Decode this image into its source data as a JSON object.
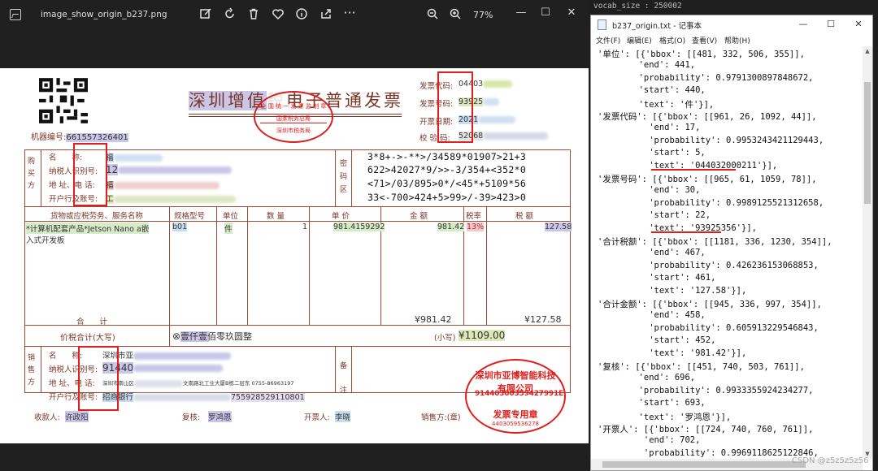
{
  "viewer": {
    "title": "image_show_origin_b237.png",
    "zoom": "77%",
    "icons": [
      "edit-icon",
      "rotate-icon",
      "delete-icon",
      "favorite-icon",
      "info-icon",
      "share-icon",
      "more-icon",
      "zoom-out-icon",
      "zoom-in-icon"
    ]
  },
  "invoice": {
    "title_prefix": "深圳增值",
    "title_suffix": "电子普通发票",
    "title_mid": "税",
    "stamp_top": "全 国 统 一 发 票 监 制 章",
    "stamp_mid": "国家税务总局",
    "stamp_bottom": "深圳市税务局",
    "meta": [
      {
        "label": "发票代码:",
        "value": "04403"
      },
      {
        "label": "发票号码:",
        "value": "93925"
      },
      {
        "label": "开票日期:",
        "value": "2021"
      },
      {
        "label": "校 验 码:",
        "value": "52068"
      }
    ],
    "machine_label": "机器编号:",
    "machine_value": "661557326401",
    "buyer_side": "购买方",
    "buyer_labels": [
      "名　　称:",
      "纳税人识别号:",
      "地 址、电 话:",
      "开户行及账号:"
    ],
    "buyer_values": [
      "福",
      "12",
      "福",
      "工"
    ],
    "cipher_side": "密码区",
    "cipher": [
      "3*8+->-**>/34589*01907>21+3",
      "622>42027*9/>>-3/354+<352*0",
      "<71>/03/895>0*/<45*+5109*56",
      "33<-700>424+5>99>/-39>423>0"
    ],
    "columns": [
      "货物或应税劳务、服务名称",
      "规格型号",
      "单位",
      "数 量",
      "单 价",
      "金 额",
      "税率",
      "税 额"
    ],
    "item": {
      "name_line1": "*计算机配套产品*Jetson Nano a嵌",
      "name_line2": "入式开发板",
      "spec": "b01",
      "unit": "件",
      "qty": "1",
      "price": "981.4159292",
      "amount": "981.42",
      "rate": "13%",
      "tax": "127.58"
    },
    "total_label": "合　　计",
    "total_amount": "¥981.42",
    "total_tax": "¥127.58",
    "grand_label": "价税合计(大写)",
    "grand_words": "壹仟壹佰零玖圆整",
    "grand_small_label": "(小写)",
    "grand_value": "¥1109.00",
    "seller_side": "销售方",
    "seller_labels": [
      "名　　称:",
      "纳税人识别号:",
      "地 址、电 话:",
      "开户行及账号:"
    ],
    "seller_name": "深圳市亚",
    "seller_tax": "91440",
    "seller_addr": "深圳市南山区",
    "seller_addr_tail": "文南路北工业大厦B栋二层东 0755-86963197",
    "seller_bank": "招商银行",
    "seller_bank_acct": "755928529110801",
    "remark_label": "备注",
    "seal_top": "深圳市亚博智能科技有限公司",
    "seal_tax": "91440300359427991E",
    "seal_bottom": "发票专用章",
    "seal_code": "4403059536278",
    "footer": [
      {
        "label": "收款人:",
        "value": "许政阳"
      },
      {
        "label": "复核:",
        "value": "罗鸿恩"
      },
      {
        "label": "开票人:",
        "value": "李晓"
      },
      {
        "label": "销售方:(章)",
        "value": ""
      }
    ]
  },
  "notepad": {
    "title": "b237_origin.txt - 记事本",
    "menu": [
      "文件(F)",
      "编辑(E)",
      "格式(O)",
      "查看(V)",
      "帮助(H)"
    ],
    "lines": [
      "'单位': [{'bbox': [[481, 332, 506, 355]],",
      "        'end': 441,",
      "        'probability': 0.9791300897848672,",
      "        'start': 440,",
      "        'text': '件'}],",
      "'发票代码': [{'bbox': [[961, 26, 1092, 44]],",
      "          'end': 17,",
      "          'probability': 0.9953243421129443,",
      "          'start': 5,",
      "          'text': '044032000211'}],",
      "'发票号码': [{'bbox': [[965, 61, 1059, 78]],",
      "          'end': 30,",
      "          'probability': 0.9989125521312658,",
      "          'start': 22,",
      "          'text': '93925356'}],",
      "'合计税额': [{'bbox': [[1181, 336, 1230, 354]],",
      "          'end': 467,",
      "          'probability': 0.426236153068853,",
      "          'start': 461,",
      "          'text': '127.58'}],",
      "'合计金额': [{'bbox': [[945, 336, 997, 354]],",
      "          'end': 458,",
      "          'probability': 0.605913229546843,",
      "          'start': 452,",
      "          'text': '981.42'}],",
      "'复核': [{'bbox': [[451, 740, 503, 761]],",
      "        'end': 696,",
      "        'probability': 0.9933355924234277,",
      "        'start': 693,",
      "        'text': '罗鸿恩'}],",
      "'开票人': [{'bbox': [[724, 740, 760, 761]],",
      "         'end': 702,",
      "         'probability': 0.9969118625122846,"
    ]
  },
  "background": {
    "top_text": "vocab_size : 250002",
    "watermark": "CSDN @z5z5z5z56"
  },
  "colors": {
    "stamp_red": "#e31b1b",
    "invoice_brown": "#7a3626",
    "annotation_red": "#e51c1c"
  }
}
